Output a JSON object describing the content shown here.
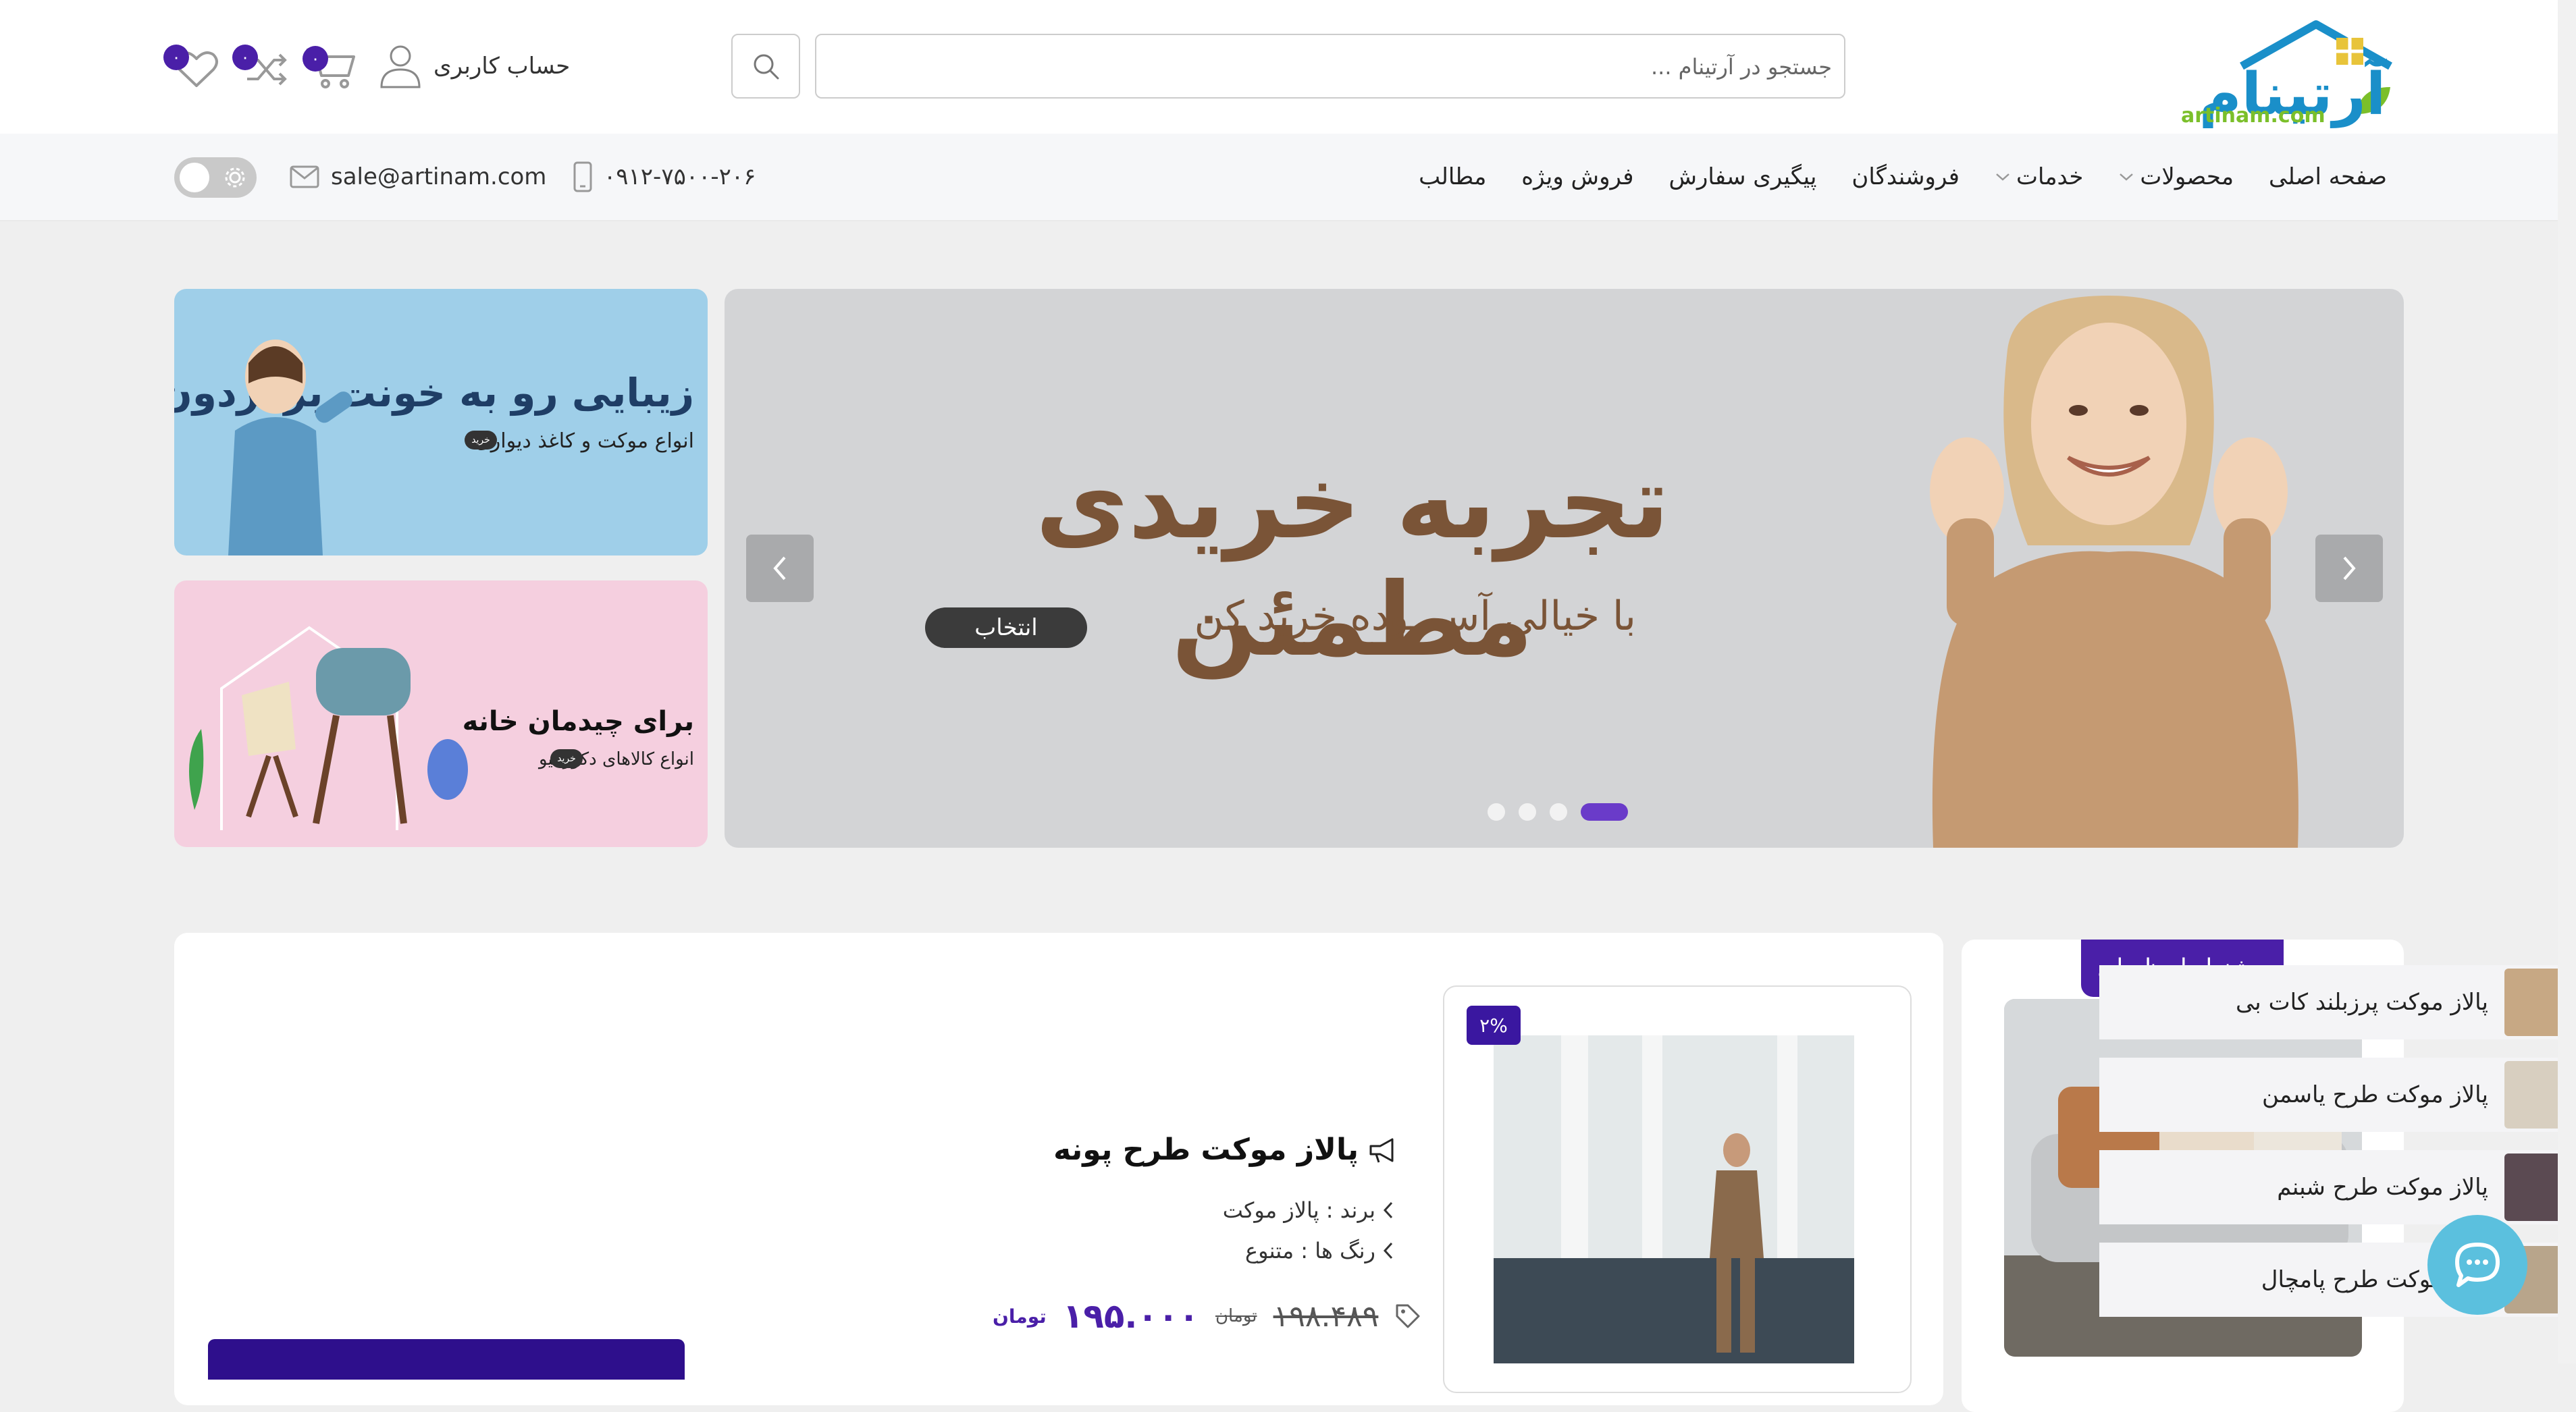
{
  "header": {
    "logo_text": "آرتینام",
    "logo_sub": "artinam.com",
    "search_placeholder": "جستجو در آرتینام ...",
    "account_label": "حساب کاربری",
    "cart_count": "۰",
    "compare_count": "۰",
    "wishlist_count": "۰"
  },
  "nav": {
    "items": [
      {
        "label": "صفحه اصلی"
      },
      {
        "label": "محصولات"
      },
      {
        "label": "خدمات"
      },
      {
        "label": "فروشندگان"
      },
      {
        "label": "پیگیری سفارش"
      },
      {
        "label": "فروش ویژه"
      },
      {
        "label": "مطالب"
      }
    ],
    "phone": "۰۹۱۲-۷۵۰۰-۲۰۶",
    "email": "sale@artinam.com"
  },
  "slider": {
    "title": "تجربه خریدی مطمئن",
    "subtitle": "با خیالی آســـوده خرید کن",
    "button_label": "انتخاب",
    "dots": 4,
    "active_dot": 4
  },
  "banners": [
    {
      "title": "زیبایی رو به خونت برگردون",
      "subtitle": "انواع موکت و کاغذ دیواری",
      "tag": "خرید"
    },
    {
      "title": "برای چیدمان خانه",
      "subtitle": "انواع کالاهای دکوراتیو",
      "tag": "خرید"
    }
  ],
  "offer": {
    "label": "پیشنهاد لحظه ای"
  },
  "product": {
    "discount": "۲%",
    "title": "پالاز موکت طرح پونه",
    "brand_line": "برند : پالاز موکت",
    "color_line": "رنگ ها : متنوع",
    "old_price": "۱۹۸.۴۸۹",
    "old_currency": "تومان",
    "price": "۱۹۵.۰۰۰",
    "currency": "تومان"
  },
  "related": [
    {
      "label": "پالاز موکت پرزبلند کات بی"
    },
    {
      "label": "پالاز موکت طرح یاسمن"
    },
    {
      "label": "پالاز موکت طرح شبنم"
    },
    {
      "label": "پالاز موکت طرح پامچال"
    }
  ],
  "colors": {
    "accent": "#4a1fa8",
    "slide_text": "#7a5437",
    "chat": "#5bc0de"
  }
}
